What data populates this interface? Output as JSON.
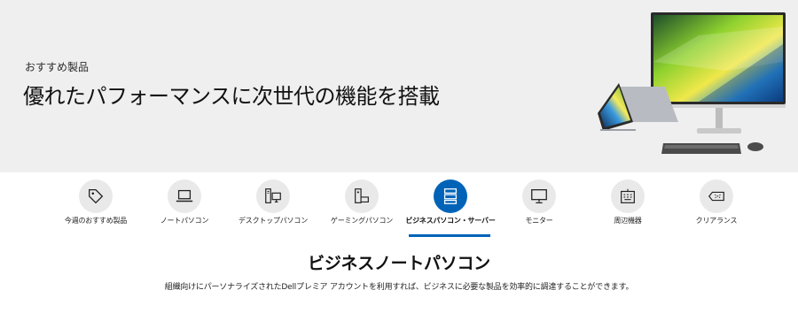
{
  "hero": {
    "eyebrow": "おすすめ製品",
    "title": "優れたパフォーマンスに次世代の機能を搭載",
    "image": "monitor-laptop-keyboard-mouse"
  },
  "categories": [
    {
      "label": "今週のおすすめ製品",
      "icon": "price-tag-icon",
      "active": false
    },
    {
      "label": "ノートパソコン",
      "icon": "laptop-icon",
      "active": false
    },
    {
      "label": "デスクトップパソコン",
      "icon": "desktop-tower-icon",
      "active": false
    },
    {
      "label": "ゲーミングパソコン",
      "icon": "gaming-pc-icon",
      "active": false
    },
    {
      "label": "ビジネスパソコン・サーバー",
      "icon": "server-icon",
      "active": true
    },
    {
      "label": "モニター",
      "icon": "monitor-icon",
      "active": false
    },
    {
      "label": "周辺機器",
      "icon": "keyboard-icon",
      "active": false
    },
    {
      "label": "クリアランス",
      "icon": "clearance-tag-icon",
      "active": false
    }
  ],
  "section": {
    "title": "ビジネスノートパソコン",
    "description": "組織向けにパーソナライズされたDellプレミア アカウントを利用すれば、ビジネスに必要な製品を効率的に調達することができます。"
  },
  "colors": {
    "accent": "#0063b8",
    "hero_bg": "#efefef",
    "icon_circle": "#e9e9e9"
  }
}
